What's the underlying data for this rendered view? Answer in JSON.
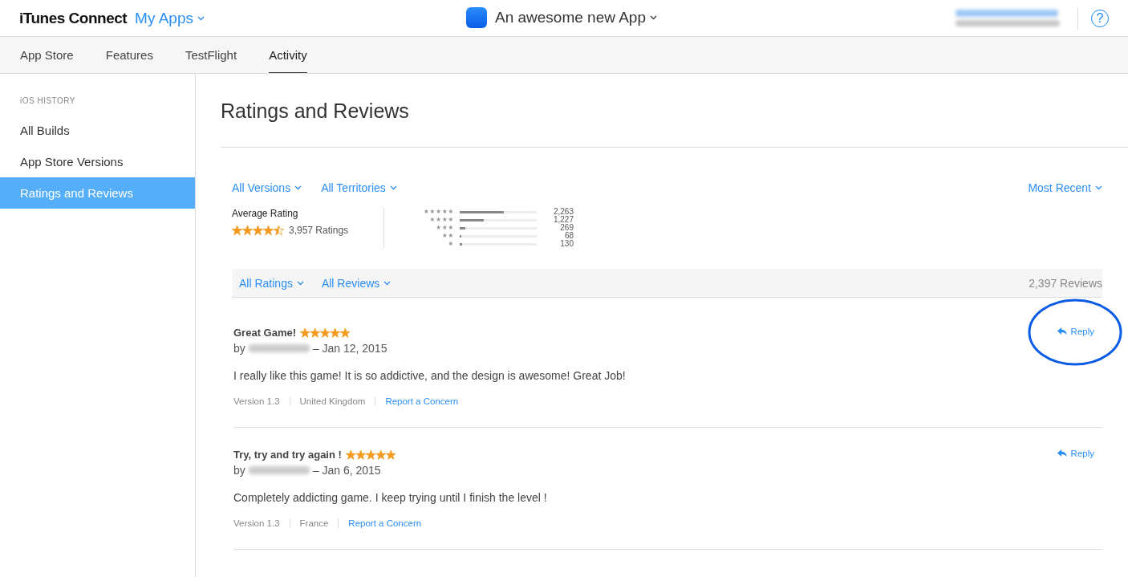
{
  "header": {
    "brand": "iTunes Connect",
    "apps_menu": "My Apps",
    "app_title": "An awesome new App",
    "help": "?"
  },
  "tabs": [
    {
      "label": "App Store",
      "selected": false
    },
    {
      "label": "Features",
      "selected": false
    },
    {
      "label": "TestFlight",
      "selected": false
    },
    {
      "label": "Activity",
      "selected": true
    }
  ],
  "sidebar": {
    "section": "iOS HISTORY",
    "items": [
      {
        "label": "All Builds",
        "selected": false
      },
      {
        "label": "App Store Versions",
        "selected": false
      },
      {
        "label": "Ratings and Reviews",
        "selected": true
      }
    ]
  },
  "page_title": "Ratings and Reviews",
  "filters": {
    "versions": "All Versions",
    "territories": "All Territories",
    "sort": "Most Recent"
  },
  "summary": {
    "label": "Average Rating",
    "stars": 4.5,
    "count": "3,957 Ratings",
    "distribution": [
      {
        "label": "★★★★★",
        "level": 0.57,
        "count": "2,263"
      },
      {
        "label": "★★★★",
        "level": 0.31,
        "count": "1,227"
      },
      {
        "label": "★★★",
        "level": 0.07,
        "count": "269"
      },
      {
        "label": "★★",
        "level": 0.02,
        "count": "68"
      },
      {
        "label": "★",
        "level": 0.03,
        "count": "130"
      }
    ]
  },
  "review_filters": {
    "ratings": "All Ratings",
    "reviews": "All Reviews",
    "total": "2,397 Reviews"
  },
  "reviews": [
    {
      "title": "Great Game!",
      "stars": 5,
      "by": "by",
      "date": "– Jan 12, 2015",
      "body": "I really like this game! It is so addictive, and the design is awesome! Great Job!",
      "version": "Version 1.3",
      "territory": "United Kingdom",
      "report": "Report a Concern",
      "reply": "Reply",
      "highlighted": true
    },
    {
      "title": "Try, try and try again !",
      "stars": 5,
      "by": "by",
      "date": "– Jan 6, 2015",
      "body": "Completely addicting game. I keep trying until I finish the level !",
      "version": "Version 1.3",
      "territory": "France",
      "report": "Report a Concern",
      "reply": "Reply",
      "highlighted": false
    }
  ]
}
